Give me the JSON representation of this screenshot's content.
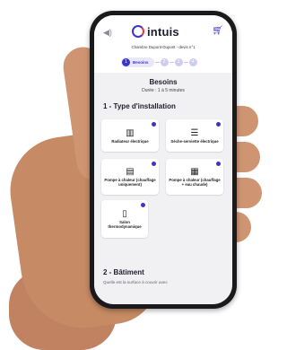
{
  "header": {
    "logo_text": "intuis",
    "devis_line": "Chambre Dupont-Dupont - devis n°1"
  },
  "stepper": {
    "active_label": "Besoins",
    "steps": [
      "1",
      "2",
      "3",
      "4"
    ]
  },
  "main": {
    "title": "Besoins",
    "duration": "Durée : 1 à 5 minutes",
    "section1_title": "1 - Type d'installation",
    "cards": [
      {
        "label": "Radiateur électrique",
        "icon": "radiator-icon"
      },
      {
        "label": "Sèche-serviette électrique",
        "icon": "towel-dryer-icon"
      },
      {
        "label": "Pompe à chaleur (chauffage uniquement)",
        "icon": "heat-pump-icon"
      },
      {
        "label": "Pompe à chaleur (chauffage + eau chaude)",
        "icon": "heat-pump-water-icon"
      },
      {
        "label": "Salon thermodynamique",
        "icon": "water-heater-icon"
      }
    ],
    "section2_title": "2 - Bâtiment",
    "section2_sub": "Quelle est la surface à couvrir avec"
  },
  "colors": {
    "accent": "#3a35c9",
    "logo_red": "#e23a4a"
  }
}
